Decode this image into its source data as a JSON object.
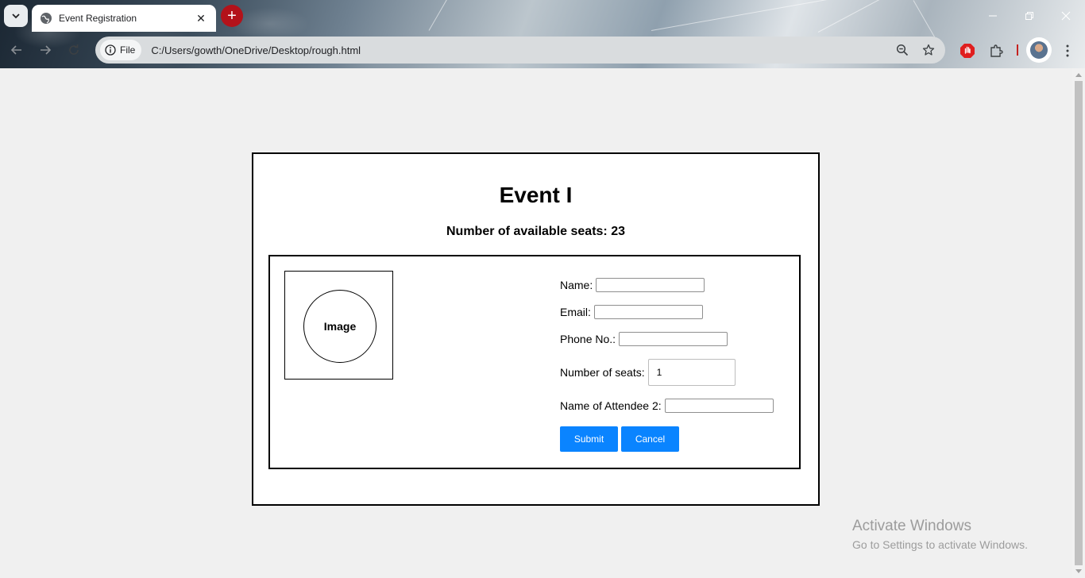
{
  "browser": {
    "tab": {
      "title": "Event Registration"
    },
    "omnibox": {
      "site_chip_label": "File",
      "url": "C:/Users/gowth/OneDrive/Desktop/rough.html"
    },
    "colors": {
      "new_tab_button": "#b3121a",
      "extension_icon": "#e01e1e"
    }
  },
  "page": {
    "event_title": "Event I",
    "seats_available": "Number of available seats: 23",
    "image_placeholder": "Image",
    "form": {
      "name_label": "Name:",
      "name_value": "",
      "email_label": "Email:",
      "email_value": "",
      "phone_label": "Phone No.:",
      "phone_value": "",
      "seats_label": "Number of seats:",
      "seats_value": "1",
      "attendee2_label": "Name of Attendee 2:",
      "attendee2_value": ""
    },
    "buttons": {
      "submit": "Submit",
      "cancel": "Cancel"
    },
    "button_color": "#0a84ff"
  },
  "os": {
    "watermark_title": "Activate Windows",
    "watermark_subtitle": "Go to Settings to activate Windows."
  }
}
